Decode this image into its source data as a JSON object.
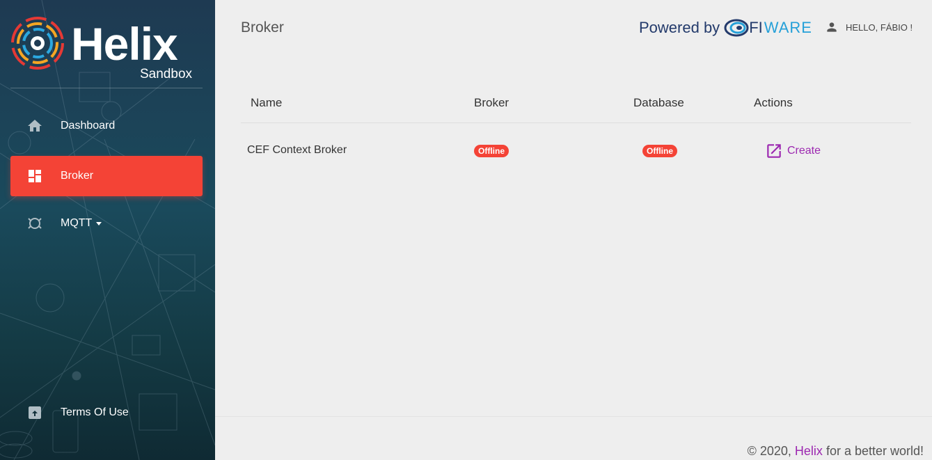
{
  "sidebar": {
    "logo_word": "Helix",
    "logo_sub": "Sandbox",
    "items": [
      {
        "label": "Dashboard",
        "icon": "home-icon"
      },
      {
        "label": "Broker",
        "icon": "dashboard-icon"
      },
      {
        "label": "MQTT",
        "icon": "mqtt-icon"
      },
      {
        "label": "Terms Of Use",
        "icon": "archive-icon"
      }
    ],
    "active_item": "Broker"
  },
  "header": {
    "title": "Broker",
    "powered_by": "Powered by",
    "fiware_fi": "FI",
    "fiware_rest": "WARE",
    "user_greeting": "HELLO, FÁBIO !"
  },
  "table": {
    "columns": [
      "Name",
      "Broker",
      "Database",
      "Actions"
    ],
    "rows": [
      {
        "name": "CEF Context Broker",
        "broker_status": "Offline",
        "database_status": "Offline",
        "action": "Create"
      }
    ]
  },
  "footer": {
    "prefix": "© 2020,",
    "brand": "Helix",
    "suffix": "for a better world!"
  },
  "colors": {
    "accent_red": "#f44336",
    "link_purple": "#9c27b0",
    "fiware_blue": "#233a6b",
    "fiware_light": "#25a0d8"
  }
}
